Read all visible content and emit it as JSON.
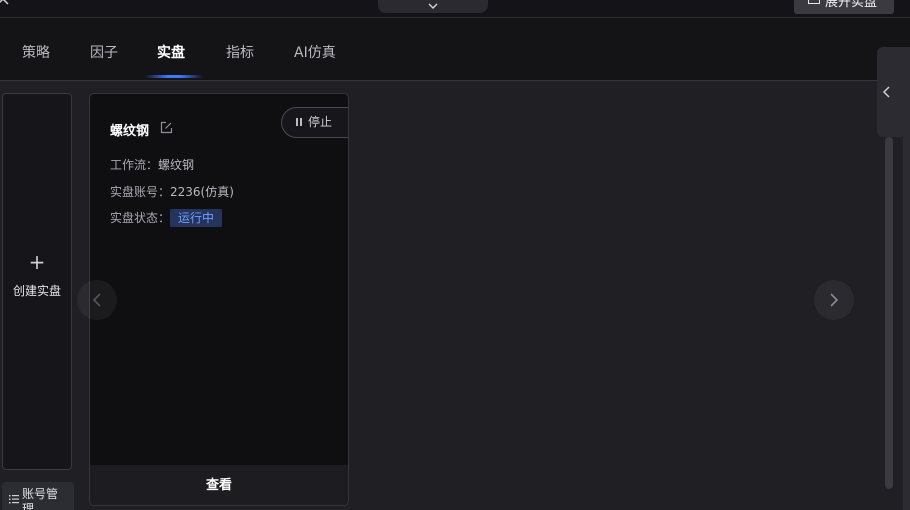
{
  "topbar": {
    "expand_label": "展开实盘"
  },
  "nav": {
    "tabs": [
      {
        "label": "策略",
        "active": false
      },
      {
        "label": "因子",
        "active": false
      },
      {
        "label": "实盘",
        "active": true
      },
      {
        "label": "指标",
        "active": false
      },
      {
        "label": "AI仿真",
        "active": false
      }
    ]
  },
  "sidebar": {
    "create_label": "创建实盘",
    "create_icon": "plus-icon",
    "account_label": "账号管理"
  },
  "card": {
    "title": "螺纹钢",
    "stop_label": "停止",
    "workflow_label": "工作流：",
    "workflow_value": "螺纹钢",
    "account_label": "实盘账号：",
    "account_value": "2236(仿真)",
    "status_label": "实盘状态：",
    "status_value": "运行中",
    "view_label": "查看"
  },
  "colors": {
    "accent": "#3b7bff",
    "status_bg": "#24345c",
    "status_text": "#6ea0ff"
  }
}
